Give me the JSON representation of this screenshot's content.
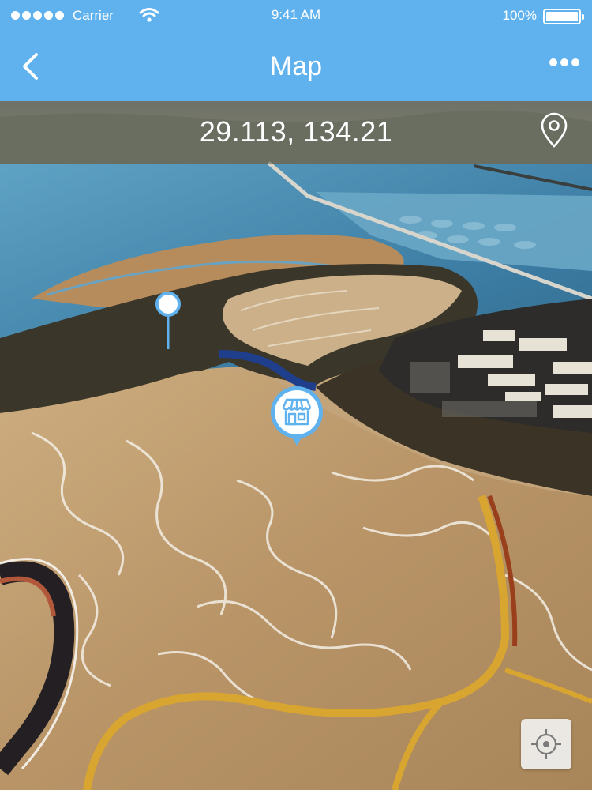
{
  "status_bar": {
    "carrier": "Carrier",
    "time": "9:41 AM",
    "battery": "100%",
    "signal_dots": 5,
    "wifi_icon": "wifi-icon",
    "battery_icon": "battery-icon"
  },
  "nav": {
    "title": "Map",
    "back_icon": "chevron-left-icon",
    "more_icon": "ellipsis-icon",
    "background_color": "#5fb2ee"
  },
  "map": {
    "coordinates": "29.113, 134.21",
    "coord_icon": "location-pin-icon",
    "markers": [
      {
        "type": "pin",
        "icon": "map-pin-icon"
      },
      {
        "type": "store",
        "icon": "store-icon"
      }
    ],
    "locate_icon": "crosshair-icon",
    "accent_color": "#5fb2ee"
  }
}
